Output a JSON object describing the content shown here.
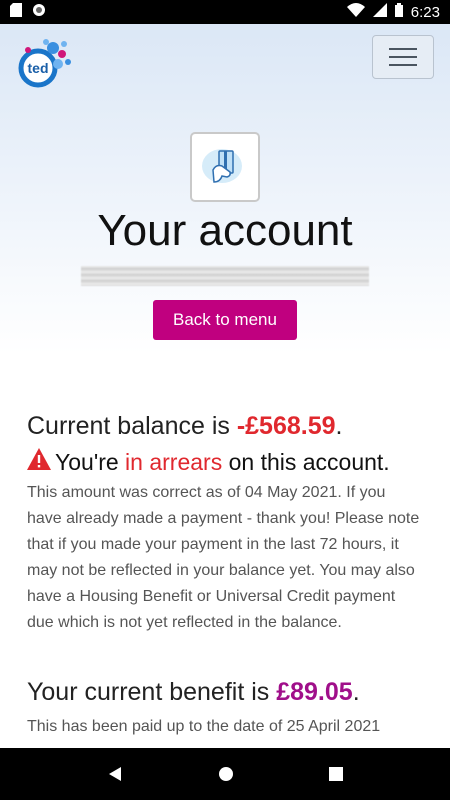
{
  "status_bar": {
    "time": "6:23",
    "icons": [
      "sd-card-icon",
      "sync-icon",
      "wifi-icon",
      "signal-icon",
      "battery-icon"
    ]
  },
  "header": {
    "logo_text": "ted",
    "menu_icon": "hamburger-icon"
  },
  "hero": {
    "icon": "card-payment-icon",
    "title": "Your account",
    "back_button": "Back to menu"
  },
  "balance": {
    "prefix": "Current balance is ",
    "amount": "-£568.59",
    "suffix": ".",
    "arrears_prefix": "You're ",
    "arrears_word": "in arrears",
    "arrears_suffix": " on this account.",
    "details": "This amount was correct as of 04 May 2021. If you have already made a payment - thank you! Please note that if you made your payment in the last 72 hours, it may not be reflected in your balance yet. You may also have a Housing Benefit or Universal Credit payment due which is not yet reflected in the balance."
  },
  "benefit": {
    "prefix": "Your current benefit is ",
    "amount": "£89.05",
    "suffix": ".",
    "details": "This has been paid up to the date of 25 April 2021"
  },
  "nav": {
    "icons": [
      "back-icon",
      "home-icon",
      "recents-icon"
    ]
  },
  "colors": {
    "accent": "#c0007f",
    "negative": "#e0282e",
    "benefit": "#a00f8a"
  }
}
